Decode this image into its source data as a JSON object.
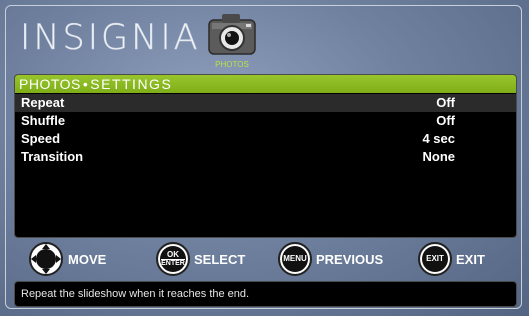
{
  "brand": "INSIGNIA",
  "app_icon": {
    "icon": "camera-icon",
    "label": "PHOTOS"
  },
  "menu": {
    "category": "PHOTOS",
    "separator": "•",
    "title": "SETTINGS",
    "rows": [
      {
        "label": "Repeat",
        "value": "Off",
        "selected": true
      },
      {
        "label": "Shuffle",
        "value": "Off",
        "selected": false
      },
      {
        "label": "Speed",
        "value": "4 sec",
        "selected": false
      },
      {
        "label": "Transition",
        "value": "None",
        "selected": false
      }
    ]
  },
  "controls": {
    "move": {
      "icon": "dpad-icon",
      "label": "MOVE"
    },
    "select": {
      "icon_top": "OK",
      "icon_bottom": "ENTER",
      "label": "SELECT"
    },
    "previous": {
      "icon_text": "MENU",
      "label": "PREVIOUS"
    },
    "exit": {
      "icon_text": "EXIT",
      "label": "EXIT"
    }
  },
  "help_text": "Repeat the slideshow when it reaches the end.",
  "colors": {
    "accent": "#8dbb22",
    "label_green": "#b9e04a"
  }
}
